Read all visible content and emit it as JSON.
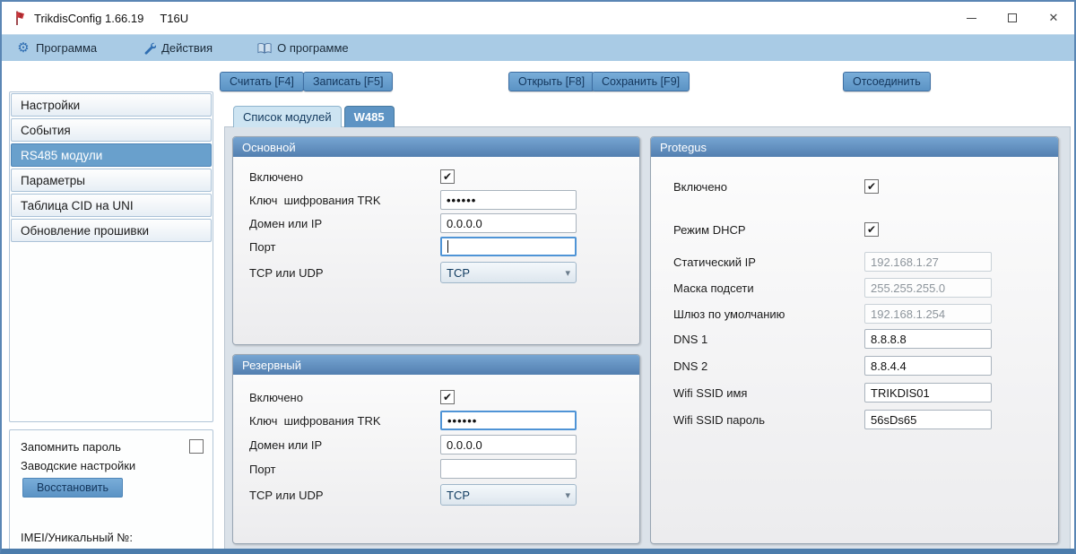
{
  "window": {
    "title": "TrikdisConfig 1.66.19",
    "device": "T16U"
  },
  "menu": {
    "items": [
      {
        "label": "Программа",
        "icon": "gear-icon"
      },
      {
        "label": "Действия",
        "icon": "wrench-icon"
      },
      {
        "label": "О программе",
        "icon": "book-icon"
      }
    ]
  },
  "toolbar": {
    "read": "Считать [F4]",
    "write": "Записать [F5]",
    "open": "Открыть [F8]",
    "save": "Сохранить [F9]",
    "disconnect": "Отсоединить"
  },
  "sidebar": {
    "items": [
      {
        "label": "Настройки",
        "selected": false
      },
      {
        "label": "События",
        "selected": false
      },
      {
        "label": "RS485 модули",
        "selected": true
      },
      {
        "label": "Параметры",
        "selected": false
      },
      {
        "label": "Таблица CID на UNI",
        "selected": false
      },
      {
        "label": "Обновление прошивки",
        "selected": false
      }
    ],
    "remember_password": "Запомнить пароль",
    "remember_password_checked": false,
    "factory_settings": "Заводские настройки",
    "restore": "Восстановить",
    "imei": "IMEI/Уникальный №:"
  },
  "tabs": {
    "modules": "Список модулей",
    "w485": "W485",
    "active": "W485"
  },
  "groups": {
    "primary": {
      "title": "Основной",
      "enabled": "Включено",
      "enabled_checked": true,
      "key": "Ключ  шифрования TRK",
      "key_value": "••••••",
      "domain": "Домен или IP",
      "domain_value": "0.0.0.0",
      "port": "Порт",
      "port_value": "",
      "protocol": "TCP или UDP",
      "protocol_value": "TCP"
    },
    "backup": {
      "title": "Резервный",
      "enabled": "Включено",
      "enabled_checked": true,
      "key": "Ключ  шифрования TRK",
      "key_value": "••••••",
      "domain": "Домен или IP",
      "domain_value": "0.0.0.0",
      "port": "Порт",
      "port_value": "",
      "protocol": "TCP или UDP",
      "protocol_value": "TCP"
    },
    "protegus": {
      "title": "Protegus",
      "enabled": "Включено",
      "enabled_checked": true,
      "dhcp": "Режим DHCP",
      "dhcp_checked": true,
      "static_ip": "Статический IP",
      "static_ip_value": "192.168.1.27",
      "subnet": "Маска подсети",
      "subnet_value": "255.255.255.0",
      "gateway": "Шлюз по умолчанию",
      "gateway_value": "192.168.1.254",
      "dns1": "DNS 1",
      "dns1_value": "8.8.8.8",
      "dns2": "DNS 2",
      "dns2_value": "8.8.4.4",
      "ssid": "Wifi SSID имя",
      "ssid_value": "TRIKDIS01",
      "ssid_password": "Wifi SSID пароль",
      "ssid_password_value": "56sDs65"
    }
  },
  "glyphs": {
    "check": "✔",
    "dropdown_arrow": "▾",
    "close": "✕",
    "gear": "⚙"
  },
  "colors": {
    "accent": "#5b93c5",
    "menubar": "#a9cbe5",
    "group_header": "#5e90c0",
    "selected_nav": "#69a0cc",
    "window_border": "#5a86b4"
  }
}
